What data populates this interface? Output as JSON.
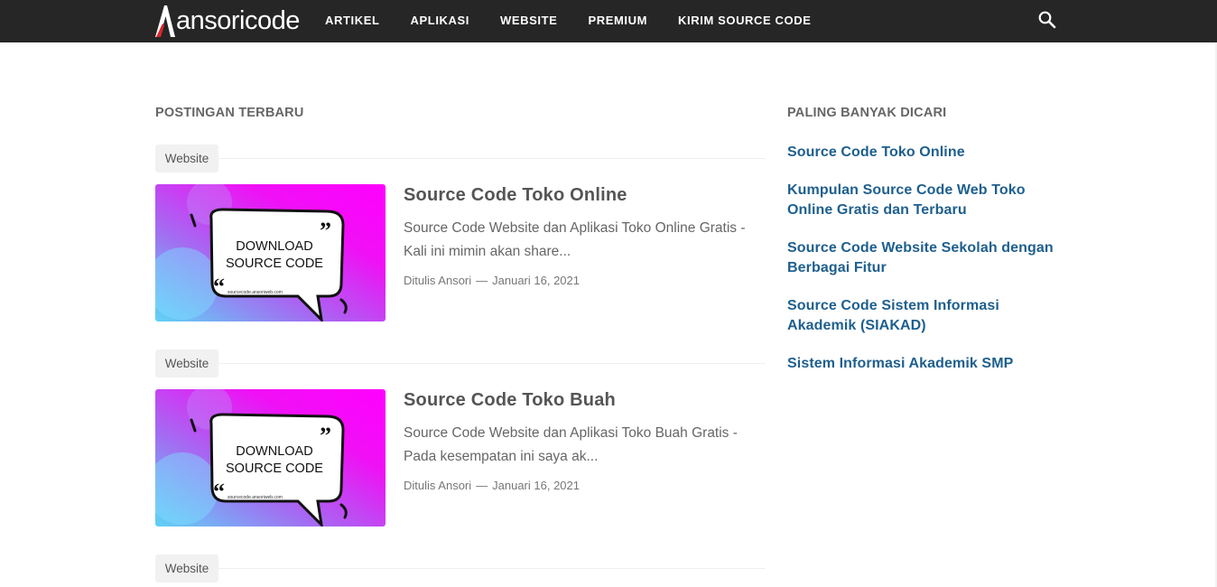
{
  "header": {
    "logo_text": "ansoricode",
    "nav": [
      "ARTIKEL",
      "APLIKASI",
      "WEBSITE",
      "PREMIUM",
      "KIRIM SOURCE CODE"
    ]
  },
  "main": {
    "section_title": "POSTINGAN TERBARU",
    "posts": [
      {
        "label": "Website",
        "title": "Source Code Toko Online",
        "snippet": "Source Code Website dan Aplikasi Toko Online Gratis - Kali ini mimin akan share...",
        "author": "Ditulis Ansori",
        "date": "Januari 16, 2021",
        "thumb": {
          "line1": "DOWNLOAD",
          "line2": "SOURCE CODE",
          "site": "sourcecode.ansoriweb.com"
        }
      },
      {
        "label": "Website",
        "title": "Source Code Toko Buah",
        "snippet": "Source Code Website dan Aplikasi Toko Buah Gratis - Pada kesempatan ini saya ak...",
        "author": "Ditulis Ansori",
        "date": "Januari 16, 2021",
        "thumb": {
          "line1": "DOWNLOAD",
          "line2": "SOURCE CODE",
          "site": "sourcecode.ansoriweb.com"
        }
      }
    ],
    "next_label": "Website"
  },
  "sidebar": {
    "title": "PALING BANYAK DICARI",
    "links": [
      "Source Code Toko Online",
      "Kumpulan Source Code Web Toko Online Gratis dan Terbaru",
      "Source Code Website Sekolah dengan Berbagai Fitur",
      "Source Code Sistem Informasi Akademik (SIAKAD)",
      "Sistem Informasi Akademik SMP"
    ]
  },
  "colors": {
    "topbar": "#262626",
    "link": "#1e5f8e",
    "thumb_magenta": "#ff00ff",
    "thumb_blue": "#5fd3f5"
  }
}
